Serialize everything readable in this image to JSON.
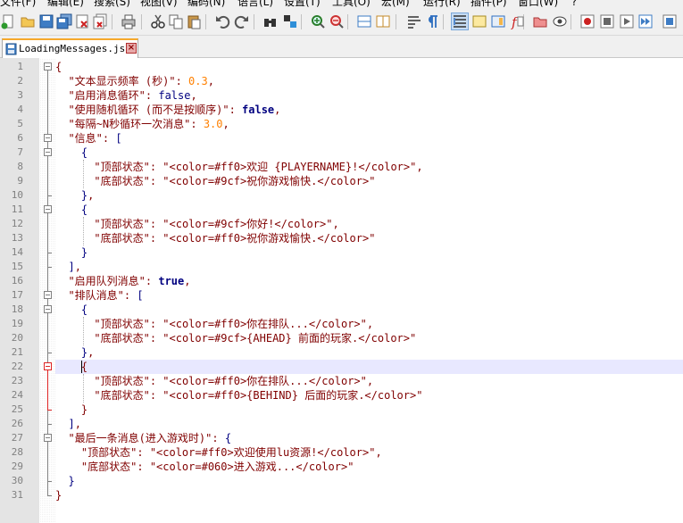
{
  "menu": [
    "文件(F)",
    "编辑(E)",
    "搜索(S)",
    "视图(V)",
    "编码(N)",
    "语言(L)",
    "设置(T)",
    "工具(O)",
    "宏(M)",
    "运行(R)",
    "插件(P)",
    "窗口(W)",
    "?"
  ],
  "toolbar_icons": [
    "new-file-icon",
    "open-file-icon",
    "save-icon",
    "save-all-icon",
    "close-icon",
    "close-all-icon",
    "print-icon",
    "cut-icon",
    "copy-icon",
    "paste-icon",
    "undo-icon",
    "redo-icon",
    "find-icon",
    "replace-icon",
    "zoom-in-icon",
    "zoom-out-icon",
    "sync-vertical-icon",
    "sync-horizontal-icon",
    "word-wrap-icon",
    "show-all-chars-icon",
    "indent-guide-icon",
    "user-lang-icon",
    "doc-map-icon",
    "function-list-icon",
    "folder-workspace-icon",
    "monitoring-icon",
    "record-macro-icon",
    "stop-macro-icon",
    "play-macro-icon",
    "run-macro-multiple-icon",
    "save-macro-icon"
  ],
  "tab": {
    "title": "LoadingMessages.json",
    "close": "×"
  },
  "editor": {
    "current_line": 22,
    "lines": [
      {
        "num": "1",
        "indent": 0,
        "parts": [
          [
            "o",
            "{"
          ]
        ]
      },
      {
        "num": "2",
        "indent": 2,
        "parts": [
          [
            "s",
            "\"文本显示频率 (秒)\""
          ],
          [
            "o",
            ": "
          ],
          [
            "n",
            "0.3"
          ],
          [
            "o",
            ","
          ]
        ]
      },
      {
        "num": "3",
        "indent": 2,
        "parts": [
          [
            "s",
            "\"启用消息循环\""
          ],
          [
            "o",
            ": "
          ],
          [
            "k",
            "false"
          ],
          [
            "o",
            ","
          ]
        ]
      },
      {
        "num": "4",
        "indent": 2,
        "parts": [
          [
            "s",
            "\"使用随机循环 (而不是按顺序)\""
          ],
          [
            "o",
            ": "
          ],
          [
            "b",
            "false"
          ],
          [
            "o",
            ","
          ]
        ]
      },
      {
        "num": "5",
        "indent": 2,
        "parts": [
          [
            "s",
            "\"每隔~N秒循环一次消息\""
          ],
          [
            "o",
            ": "
          ],
          [
            "n",
            "3.0"
          ],
          [
            "o",
            ","
          ]
        ]
      },
      {
        "num": "6",
        "indent": 2,
        "parts": [
          [
            "s",
            "\"信息\""
          ],
          [
            "o",
            ": "
          ],
          [
            "k",
            "["
          ]
        ]
      },
      {
        "num": "7",
        "indent": 4,
        "parts": [
          [
            "k",
            "{"
          ]
        ]
      },
      {
        "num": "8",
        "indent": 6,
        "parts": [
          [
            "s",
            "\"顶部状态\""
          ],
          [
            "o",
            ": "
          ],
          [
            "s",
            "\"<color=#ff0>欢迎 {PLAYERNAME}!</color>\""
          ],
          [
            "o",
            ","
          ]
        ]
      },
      {
        "num": "9",
        "indent": 6,
        "parts": [
          [
            "s",
            "\"底部状态\""
          ],
          [
            "o",
            ": "
          ],
          [
            "s",
            "\"<color=#9cf>祝你游戏愉快.</color>\""
          ]
        ]
      },
      {
        "num": "10",
        "indent": 4,
        "parts": [
          [
            "k",
            "}"
          ],
          [
            "o",
            ","
          ]
        ]
      },
      {
        "num": "11",
        "indent": 4,
        "parts": [
          [
            "k",
            "{"
          ]
        ]
      },
      {
        "num": "12",
        "indent": 6,
        "parts": [
          [
            "s",
            "\"顶部状态\""
          ],
          [
            "o",
            ": "
          ],
          [
            "s",
            "\"<color=#9cf>你好!</color>\""
          ],
          [
            "o",
            ","
          ]
        ]
      },
      {
        "num": "13",
        "indent": 6,
        "parts": [
          [
            "s",
            "\"底部状态\""
          ],
          [
            "o",
            ": "
          ],
          [
            "s",
            "\"<color=#ff0>祝你游戏愉快.</color>\""
          ]
        ]
      },
      {
        "num": "14",
        "indent": 4,
        "parts": [
          [
            "k",
            "}"
          ]
        ]
      },
      {
        "num": "15",
        "indent": 2,
        "parts": [
          [
            "k",
            "]"
          ],
          [
            "o",
            ","
          ]
        ]
      },
      {
        "num": "16",
        "indent": 2,
        "parts": [
          [
            "s",
            "\"启用队列消息\""
          ],
          [
            "o",
            ": "
          ],
          [
            "b",
            "true"
          ],
          [
            "o",
            ","
          ]
        ]
      },
      {
        "num": "17",
        "indent": 2,
        "parts": [
          [
            "s",
            "\"排队消息\""
          ],
          [
            "o",
            ": "
          ],
          [
            "k",
            "["
          ]
        ]
      },
      {
        "num": "18",
        "indent": 4,
        "parts": [
          [
            "k",
            "{"
          ]
        ]
      },
      {
        "num": "19",
        "indent": 6,
        "parts": [
          [
            "s",
            "\"顶部状态\""
          ],
          [
            "o",
            ": "
          ],
          [
            "s",
            "\"<color=#ff0>你在排队...</color>\""
          ],
          [
            "o",
            ","
          ]
        ]
      },
      {
        "num": "20",
        "indent": 6,
        "parts": [
          [
            "s",
            "\"底部状态\""
          ],
          [
            "o",
            ": "
          ],
          [
            "s",
            "\"<color=#9cf>{AHEAD} 前面的玩家.</color>\""
          ]
        ]
      },
      {
        "num": "21",
        "indent": 4,
        "parts": [
          [
            "k",
            "}"
          ],
          [
            "o",
            ","
          ]
        ]
      },
      {
        "num": "22",
        "indent": 4,
        "parts": [
          [
            "o",
            "{"
          ]
        ]
      },
      {
        "num": "23",
        "indent": 6,
        "parts": [
          [
            "s",
            "\"顶部状态\""
          ],
          [
            "o",
            ": "
          ],
          [
            "s",
            "\"<color=#ff0>你在排队...</color>\""
          ],
          [
            "o",
            ","
          ]
        ]
      },
      {
        "num": "24",
        "indent": 6,
        "parts": [
          [
            "s",
            "\"底部状态\""
          ],
          [
            "o",
            ": "
          ],
          [
            "s",
            "\"<color=#ff0>{BEHIND} 后面的玩家.</color>\""
          ]
        ]
      },
      {
        "num": "25",
        "indent": 4,
        "parts": [
          [
            "o",
            "}"
          ]
        ]
      },
      {
        "num": "26",
        "indent": 2,
        "parts": [
          [
            "k",
            "]"
          ],
          [
            "o",
            ","
          ]
        ]
      },
      {
        "num": "27",
        "indent": 2,
        "parts": [
          [
            "s",
            "\"最后一条消息(进入游戏时)\""
          ],
          [
            "o",
            ": "
          ],
          [
            "k",
            "{"
          ]
        ]
      },
      {
        "num": "28",
        "indent": 4,
        "parts": [
          [
            "s",
            "\"顶部状态\""
          ],
          [
            "o",
            ": "
          ],
          [
            "s",
            "\"<color=#ff0>欢迎使用lu资源!</color>\""
          ],
          [
            "o",
            ","
          ]
        ]
      },
      {
        "num": "29",
        "indent": 4,
        "parts": [
          [
            "s",
            "\"底部状态\""
          ],
          [
            "o",
            ": "
          ],
          [
            "s",
            "\"<color=#060>进入游戏...</color>\""
          ]
        ]
      },
      {
        "num": "30",
        "indent": 2,
        "parts": [
          [
            "k",
            "}"
          ]
        ]
      },
      {
        "num": "31",
        "indent": 0,
        "parts": [
          [
            "o",
            "}"
          ]
        ]
      }
    ]
  }
}
